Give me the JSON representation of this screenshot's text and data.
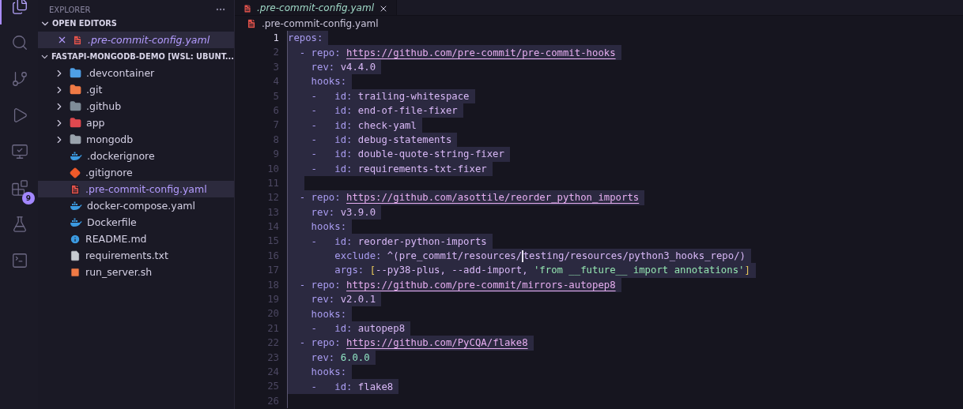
{
  "activity_bar": [
    {
      "selected": true
    },
    {
      "selected": false
    },
    {
      "selected": false
    },
    {
      "selected": false
    },
    {
      "selected": false
    },
    {
      "selected": false,
      "badge": "9"
    },
    {
      "selected": false
    },
    {
      "selected": false
    }
  ],
  "sidebar": {
    "title": "EXPLORER",
    "open_editors": {
      "label": "OPEN EDITORS",
      "expanded": true,
      "items": [
        {
          "name": ".pre-commit-config.yaml",
          "color": "#e5534b"
        }
      ]
    },
    "project": {
      "label": "FASTAPI-MONGODB-DEMO [WSL: UBUNT...",
      "expanded": true,
      "items": [
        {
          "name": ".devcontainer",
          "kind": "folder",
          "expanded": false,
          "selected": false,
          "color": "#4f9fe6"
        },
        {
          "name": ".git",
          "kind": "folder",
          "expanded": false,
          "selected": false,
          "color": "#f07a45"
        },
        {
          "name": ".github",
          "kind": "folder",
          "expanded": false,
          "selected": false,
          "color": "#7f8c98"
        },
        {
          "name": "app",
          "kind": "folder",
          "expanded": false,
          "selected": false,
          "color": "#e0484f"
        },
        {
          "name": "mongodb",
          "kind": "folder",
          "expanded": false,
          "selected": false,
          "color": "#9aa3ad"
        },
        {
          "name": ".dockerignore",
          "kind": "file",
          "selected": false,
          "color": "#3b9ae1"
        },
        {
          "name": ".gitignore",
          "kind": "file",
          "selected": false,
          "color": "#f05a2a"
        },
        {
          "name": ".pre-commit-config.yaml",
          "kind": "file",
          "selected": true,
          "color": "#e5534b"
        },
        {
          "name": "docker-compose.yaml",
          "kind": "file",
          "selected": false,
          "color": "#3b9ae1"
        },
        {
          "name": "Dockerfile",
          "kind": "file",
          "selected": false,
          "color": "#3b9ae1"
        },
        {
          "name": "README.md",
          "kind": "file",
          "selected": false,
          "color": "#3b9ae1"
        },
        {
          "name": "requirements.txt",
          "kind": "file",
          "selected": false,
          "color": "#c8ccd2"
        },
        {
          "name": "run_server.sh",
          "kind": "file",
          "selected": false,
          "color": "#f07a45"
        }
      ]
    }
  },
  "editor": {
    "tabs": [
      {
        "label": ".pre-commit-config.yaml",
        "selected": true
      }
    ],
    "breadcrumb": ".pre-commit-config.yaml",
    "lines": [
      {
        "number": "1",
        "active": true,
        "selected": true,
        "tokens": [
          {
            "kind": "key",
            "text": "repos:"
          }
        ]
      },
      {
        "number": "2",
        "active": false,
        "selected": true,
        "tokens": [
          {
            "kind": "key",
            "text": "  - repo: "
          },
          {
            "kind": "link",
            "text": "https://github.com/pre-commit/pre-commit-hooks"
          }
        ]
      },
      {
        "number": "3",
        "active": false,
        "selected": true,
        "tokens": [
          {
            "kind": "key",
            "text": "    rev: "
          },
          {
            "kind": "value",
            "text": "v4.4.0"
          }
        ]
      },
      {
        "number": "4",
        "active": false,
        "selected": true,
        "tokens": [
          {
            "kind": "key",
            "text": "    hooks:"
          }
        ]
      },
      {
        "number": "5",
        "active": false,
        "selected": true,
        "tokens": [
          {
            "kind": "key",
            "text": "    -   id: "
          },
          {
            "kind": "value",
            "text": "trailing-whitespace"
          }
        ]
      },
      {
        "number": "6",
        "active": false,
        "selected": true,
        "tokens": [
          {
            "kind": "key",
            "text": "    -   id: "
          },
          {
            "kind": "value",
            "text": "end-of-file-fixer"
          }
        ]
      },
      {
        "number": "7",
        "active": false,
        "selected": true,
        "tokens": [
          {
            "kind": "key",
            "text": "    -   id: "
          },
          {
            "kind": "value",
            "text": "check-yaml"
          }
        ]
      },
      {
        "number": "8",
        "active": false,
        "selected": true,
        "tokens": [
          {
            "kind": "key",
            "text": "    -   id: "
          },
          {
            "kind": "value",
            "text": "debug-statements"
          }
        ]
      },
      {
        "number": "9",
        "active": false,
        "selected": true,
        "tokens": [
          {
            "kind": "key",
            "text": "    -   id: "
          },
          {
            "kind": "value",
            "text": "double-quote-string-fixer"
          }
        ]
      },
      {
        "number": "10",
        "active": false,
        "selected": true,
        "tokens": [
          {
            "kind": "key",
            "text": "    -   id: "
          },
          {
            "kind": "value",
            "text": "requirements-txt-fixer"
          }
        ]
      },
      {
        "number": "11",
        "active": false,
        "selected": true
      },
      {
        "number": "12",
        "active": false,
        "selected": true,
        "tokens": [
          {
            "kind": "key",
            "text": "  - repo: "
          },
          {
            "kind": "link",
            "text": "https://github.com/asottile/reorder_python_imports"
          }
        ]
      },
      {
        "number": "13",
        "active": false,
        "selected": true,
        "tokens": [
          {
            "kind": "key",
            "text": "    rev: "
          },
          {
            "kind": "value",
            "text": "v3.9.0"
          }
        ]
      },
      {
        "number": "14",
        "active": false,
        "selected": true,
        "tokens": [
          {
            "kind": "key",
            "text": "    hooks:"
          }
        ]
      },
      {
        "number": "15",
        "active": false,
        "selected": true,
        "tokens": [
          {
            "kind": "key",
            "text": "    -   id: "
          },
          {
            "kind": "value",
            "text": "reorder-python-imports"
          }
        ]
      },
      {
        "number": "16",
        "active": false,
        "selected": true,
        "tokens": [
          {
            "kind": "key",
            "text": "        exclude: "
          },
          {
            "kind": "value",
            "text": "^(pre_commit/resources/"
          },
          {
            "kind": "cursor"
          },
          {
            "kind": "value",
            "text": "testing/resources/python3_hooks_repo/)"
          }
        ]
      },
      {
        "number": "17",
        "active": false,
        "selected": true,
        "tokens": [
          {
            "kind": "key",
            "text": "        args: "
          },
          {
            "kind": "bracket",
            "text": "["
          },
          {
            "kind": "value",
            "text": "--py38-plus, --add-import, "
          },
          {
            "kind": "string",
            "text": "'from __future__ import annotations'"
          },
          {
            "kind": "bracket",
            "text": "]"
          }
        ]
      },
      {
        "number": "18",
        "active": false,
        "selected": true,
        "tokens": [
          {
            "kind": "key",
            "text": "  - repo: "
          },
          {
            "kind": "link",
            "text": "https://github.com/pre-commit/mirrors-autopep8"
          }
        ]
      },
      {
        "number": "19",
        "active": false,
        "selected": true,
        "tokens": [
          {
            "kind": "key",
            "text": "    rev: "
          },
          {
            "kind": "value",
            "text": "v2.0.1"
          }
        ]
      },
      {
        "number": "20",
        "active": false,
        "selected": true,
        "tokens": [
          {
            "kind": "key",
            "text": "    hooks:"
          }
        ]
      },
      {
        "number": "21",
        "active": false,
        "selected": true,
        "tokens": [
          {
            "kind": "key",
            "text": "    -   id: "
          },
          {
            "kind": "value",
            "text": "autopep8"
          }
        ]
      },
      {
        "number": "22",
        "active": false,
        "selected": true,
        "tokens": [
          {
            "kind": "key",
            "text": "  - repo: "
          },
          {
            "kind": "link",
            "text": "https://github.com/PyCQA/flake8"
          }
        ]
      },
      {
        "number": "23",
        "active": false,
        "selected": true,
        "tokens": [
          {
            "kind": "key",
            "text": "    rev: "
          },
          {
            "kind": "number",
            "text": "6.0.0"
          }
        ]
      },
      {
        "number": "24",
        "active": false,
        "selected": true,
        "tokens": [
          {
            "kind": "key",
            "text": "    hooks:"
          }
        ]
      },
      {
        "number": "25",
        "active": false,
        "selected": true,
        "tokens": [
          {
            "kind": "key",
            "text": "    -   id: "
          },
          {
            "kind": "value",
            "text": "flake8"
          }
        ]
      },
      {
        "number": "26",
        "active": false,
        "selected": false
      }
    ]
  }
}
